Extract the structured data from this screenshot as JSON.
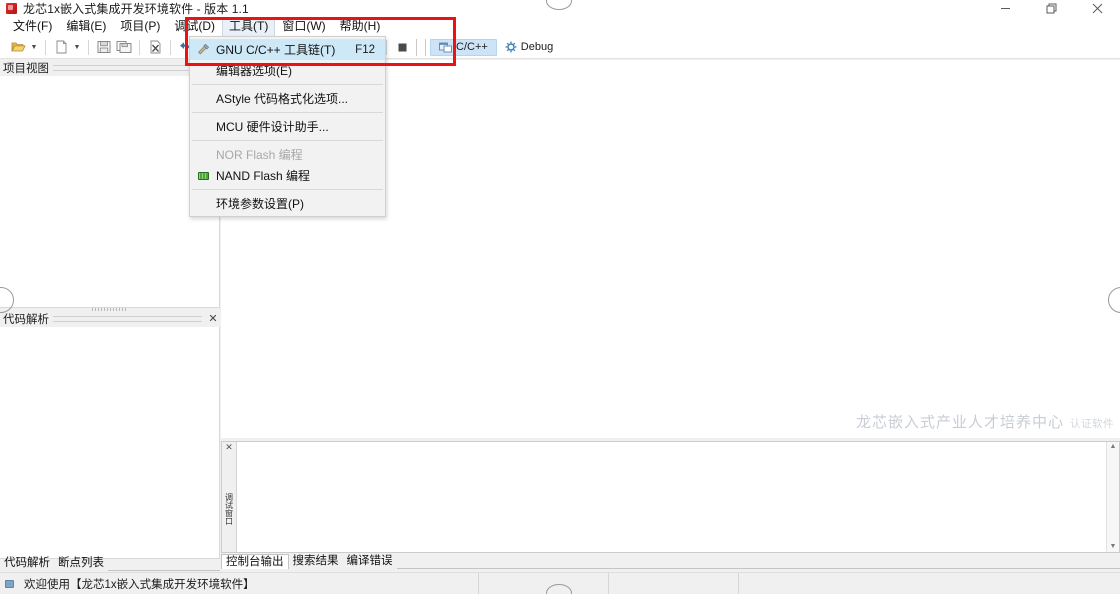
{
  "window": {
    "title": "龙芯1x嵌入式集成开发环境软件 - 版本 1.1",
    "icon": "app-logo-icon",
    "controls": {
      "minimize": "minimize-icon",
      "restore": "restore-icon",
      "close": "close-icon"
    }
  },
  "menubar": {
    "items": [
      {
        "label": "文件(F)",
        "open": false
      },
      {
        "label": "编辑(E)",
        "open": false
      },
      {
        "label": "项目(P)",
        "open": false
      },
      {
        "label": "调试(D)",
        "open": false
      },
      {
        "label": "工具(T)",
        "open": true
      },
      {
        "label": "窗口(W)",
        "open": false
      },
      {
        "label": "帮助(H)",
        "open": false
      }
    ]
  },
  "tools_menu": {
    "items": [
      {
        "label": "GNU C/C++ 工具链(T)",
        "shortcut": "F12",
        "highlighted": true,
        "disabled": false,
        "icon": "toolchain-icon"
      },
      {
        "label": "编辑器选项(E)",
        "shortcut": "",
        "highlighted": false,
        "disabled": false,
        "icon": ""
      },
      {
        "label": "AStyle 代码格式化选项...",
        "shortcut": "",
        "highlighted": false,
        "disabled": false,
        "icon": ""
      },
      {
        "label": "MCU 硬件设计助手...",
        "shortcut": "",
        "highlighted": false,
        "disabled": false,
        "icon": ""
      },
      {
        "label": "NOR Flash 编程",
        "shortcut": "",
        "highlighted": false,
        "disabled": true,
        "icon": ""
      },
      {
        "label": "NAND Flash 编程",
        "shortcut": "",
        "highlighted": false,
        "disabled": false,
        "icon": "nand-flash-icon"
      },
      {
        "label": "环境参数设置(P)",
        "shortcut": "",
        "highlighted": false,
        "disabled": false,
        "icon": ""
      }
    ]
  },
  "toolbar": {
    "buttons": [
      {
        "name": "open-project-icon",
        "glyph": "folder"
      },
      {
        "name": "open-project-dropdown-icon",
        "glyph": "caret"
      },
      {
        "name": "new-file-icon",
        "glyph": "page"
      },
      {
        "name": "new-file-dropdown-icon",
        "glyph": "caret"
      },
      {
        "name": "save-icon",
        "glyph": "floppy"
      },
      {
        "name": "save-all-icon",
        "glyph": "floppy-multi"
      },
      {
        "name": "close-file-icon",
        "glyph": "page-x"
      },
      {
        "name": "undo-icon",
        "glyph": "undo"
      },
      {
        "name": "redo-icon",
        "glyph": "redo"
      },
      {
        "name": "build-icon",
        "glyph": "hammer"
      },
      {
        "name": "run-icon",
        "glyph": "play"
      },
      {
        "name": "run-dropdown-icon",
        "glyph": "caret"
      },
      {
        "name": "build-all-icon",
        "glyph": "tree"
      },
      {
        "name": "step-over-icon",
        "glyph": "step-over"
      },
      {
        "name": "step-into-icon",
        "glyph": "step-into"
      },
      {
        "name": "step-out-icon",
        "glyph": "step-out"
      },
      {
        "name": "stop-icon",
        "glyph": "stop"
      }
    ],
    "perspectives": [
      {
        "label": "C/C++",
        "active": true,
        "icon": "cpp-perspective-icon"
      },
      {
        "label": "Debug",
        "active": false,
        "icon": "debug-perspective-icon"
      }
    ]
  },
  "panels": {
    "project_view": {
      "title": "项目视图",
      "closable": false
    },
    "code_analysis": {
      "title": "代码解析",
      "closable": true,
      "close_icon": "close-icon"
    }
  },
  "editor": {
    "watermark_main": "龙芯嵌入式产业人才培养中心",
    "watermark_sub": "认证软件"
  },
  "console": {
    "strip_label": "调试窗口",
    "strip_close_icon": "close-icon",
    "scroll_up_icon": "chevron-up-icon",
    "scroll_down_icon": "chevron-down-icon"
  },
  "bottom_tabs": {
    "left": [
      {
        "label": "代码解析",
        "selected": false
      },
      {
        "label": "断点列表",
        "selected": true
      }
    ],
    "right": [
      {
        "label": "控制台输出",
        "selected": true
      },
      {
        "label": "搜索结果",
        "selected": false
      },
      {
        "label": "编译错误",
        "selected": false
      }
    ]
  },
  "statusbar": {
    "icon": "info-icon",
    "message": "欢迎使用【龙芯1x嵌入式集成开发环境软件】"
  },
  "annotation": {
    "highlight_color": "#ee1111",
    "highlight_target": "工具(T) 菜单 / GNU C/C++ 工具链(T)"
  }
}
